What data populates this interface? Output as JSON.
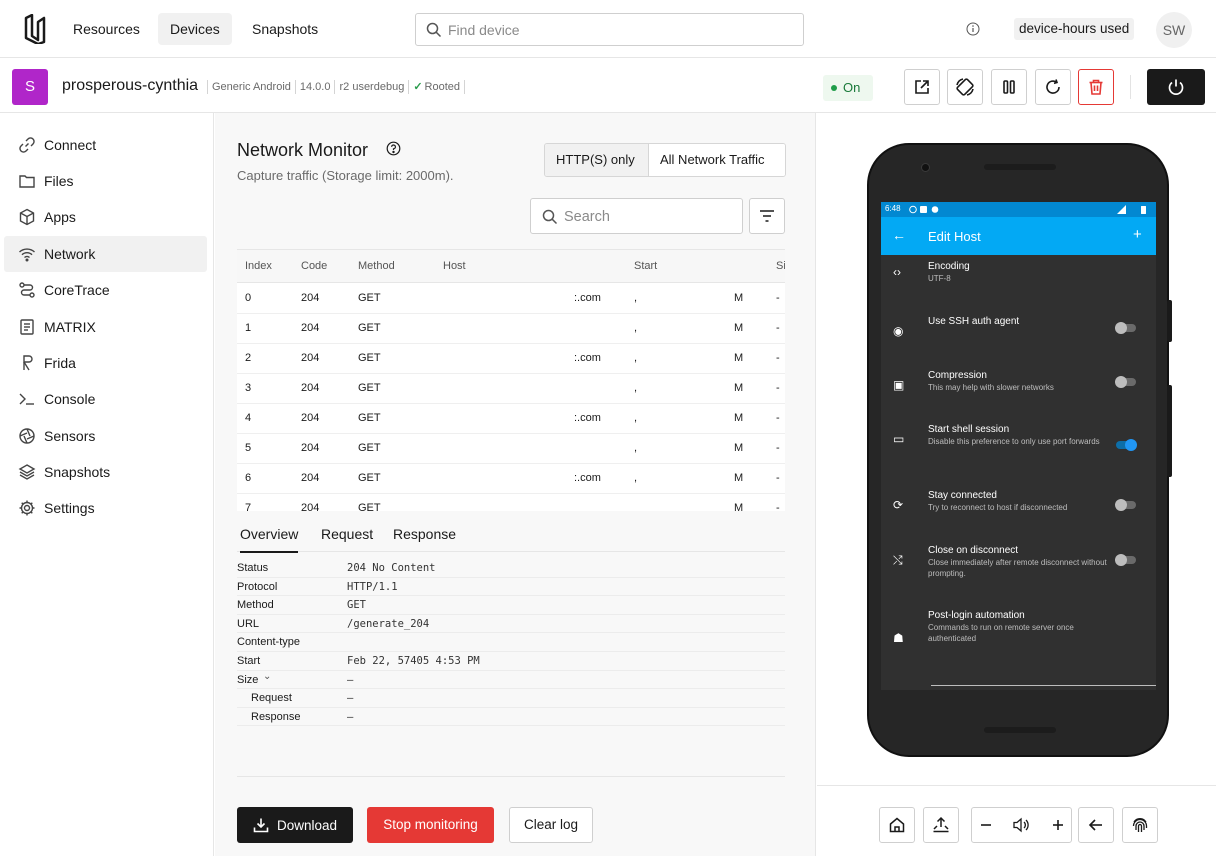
{
  "nav": {
    "items": [
      {
        "label": "Resources",
        "active": false
      },
      {
        "label": "Devices",
        "active": true
      },
      {
        "label": "Snapshots",
        "active": false
      }
    ],
    "find_placeholder": "Find device",
    "hours_label": "device-hours used",
    "user_initials": "SW"
  },
  "device": {
    "avatar_letter": "S",
    "avatar_color": "#b026c9",
    "name": "prosperous-cynthia",
    "meta": [
      "Generic Android",
      "14.0.0",
      "r2 userdebug"
    ],
    "rooted_label": "Rooted",
    "status": "On"
  },
  "sidebar": {
    "items": [
      {
        "label": "Connect",
        "icon": "link-icon"
      },
      {
        "label": "Files",
        "icon": "folder-icon"
      },
      {
        "label": "Apps",
        "icon": "cube-icon"
      },
      {
        "label": "Network",
        "icon": "wifi-icon",
        "active": true
      },
      {
        "label": "CoreTrace",
        "icon": "route-icon"
      },
      {
        "label": "MATRIX",
        "icon": "report-icon"
      },
      {
        "label": "Frida",
        "icon": "frida-icon"
      },
      {
        "label": "Console",
        "icon": "terminal-icon"
      },
      {
        "label": "Sensors",
        "icon": "aperture-icon"
      },
      {
        "label": "Snapshots",
        "icon": "layers-icon"
      },
      {
        "label": "Settings",
        "icon": "gear-icon"
      }
    ]
  },
  "monitor": {
    "title": "Network Monitor",
    "subtitle": "Capture traffic (Storage limit: 2000m).",
    "filters": [
      "HTTP(S) only",
      "All Network Traffic"
    ],
    "search_placeholder": "Search",
    "columns": [
      "Index",
      "Code",
      "Method",
      "Host",
      "Start",
      "Si"
    ],
    "rows": [
      {
        "index": "0",
        "code": "204",
        "method": "GET",
        "host": ":.com",
        "start": ",",
        "mid": "M",
        "size": "-"
      },
      {
        "index": "1",
        "code": "204",
        "method": "GET",
        "host": "",
        "start": ",",
        "mid": "M",
        "size": "-"
      },
      {
        "index": "2",
        "code": "204",
        "method": "GET",
        "host": ":.com",
        "start": ",",
        "mid": "M",
        "size": "-"
      },
      {
        "index": "3",
        "code": "204",
        "method": "GET",
        "host": "",
        "start": ",",
        "mid": "M",
        "size": "-"
      },
      {
        "index": "4",
        "code": "204",
        "method": "GET",
        "host": ":.com",
        "start": ",",
        "mid": "M",
        "size": "-"
      },
      {
        "index": "5",
        "code": "204",
        "method": "GET",
        "host": "",
        "start": ",",
        "mid": "M",
        "size": "-"
      },
      {
        "index": "6",
        "code": "204",
        "method": "GET",
        "host": ":.com",
        "start": ",",
        "mid": "M",
        "size": "-"
      },
      {
        "index": "7",
        "code": "204",
        "method": "GET",
        "host": "",
        "start": "",
        "mid": "M",
        "size": "-"
      }
    ],
    "detail_tabs": [
      "Overview",
      "Request",
      "Response"
    ],
    "details": [
      {
        "key": "Status",
        "value": "204 No Content"
      },
      {
        "key": "Protocol",
        "value": "HTTP/1.1"
      },
      {
        "key": "Method",
        "value": "GET"
      },
      {
        "key": "URL",
        "value": "/generate_204"
      },
      {
        "key": "Content-type",
        "value": ""
      },
      {
        "key": "Start",
        "value": "Feb 22, 57405 4:53 PM"
      },
      {
        "key": "Size",
        "value": "–",
        "expandable": true
      },
      {
        "key": "Request",
        "value": "–",
        "sub": true
      },
      {
        "key": "Response",
        "value": "–",
        "sub": true
      }
    ],
    "buttons": {
      "download": "Download",
      "stop": "Stop monitoring",
      "clear": "Clear log"
    }
  },
  "phone": {
    "time": "6:48",
    "screen_title": "Edit Host",
    "prefs": [
      {
        "title": "Encoding",
        "summary": "UTF-8",
        "icon": "code-icon",
        "toggle": null
      },
      {
        "title": "Use SSH auth agent",
        "summary": "",
        "icon": "globe-icon",
        "toggle": false
      },
      {
        "title": "Compression",
        "summary": "This may help with slower networks",
        "icon": "archive-icon",
        "toggle": false
      },
      {
        "title": "Start shell session",
        "summary": "Disable this preference to only use port forwards",
        "icon": "laptop-icon",
        "toggle": true
      },
      {
        "title": "Stay connected",
        "summary": "Try to reconnect to host if disconnected",
        "icon": "sync-icon",
        "toggle": false
      },
      {
        "title": "Close on disconnect",
        "summary": "Close immediately after remote disconnect without prompting.",
        "icon": "sync-off-icon",
        "toggle": false
      },
      {
        "title": "Post-login automation",
        "summary": "Commands to run on remote server once authenticated",
        "icon": "android-icon",
        "toggle": null
      }
    ]
  },
  "colors": {
    "accent_danger": "#e53935",
    "appbar": "#03a9f4",
    "statusbar": "#0288d1",
    "on_green": "#1f9d49"
  }
}
